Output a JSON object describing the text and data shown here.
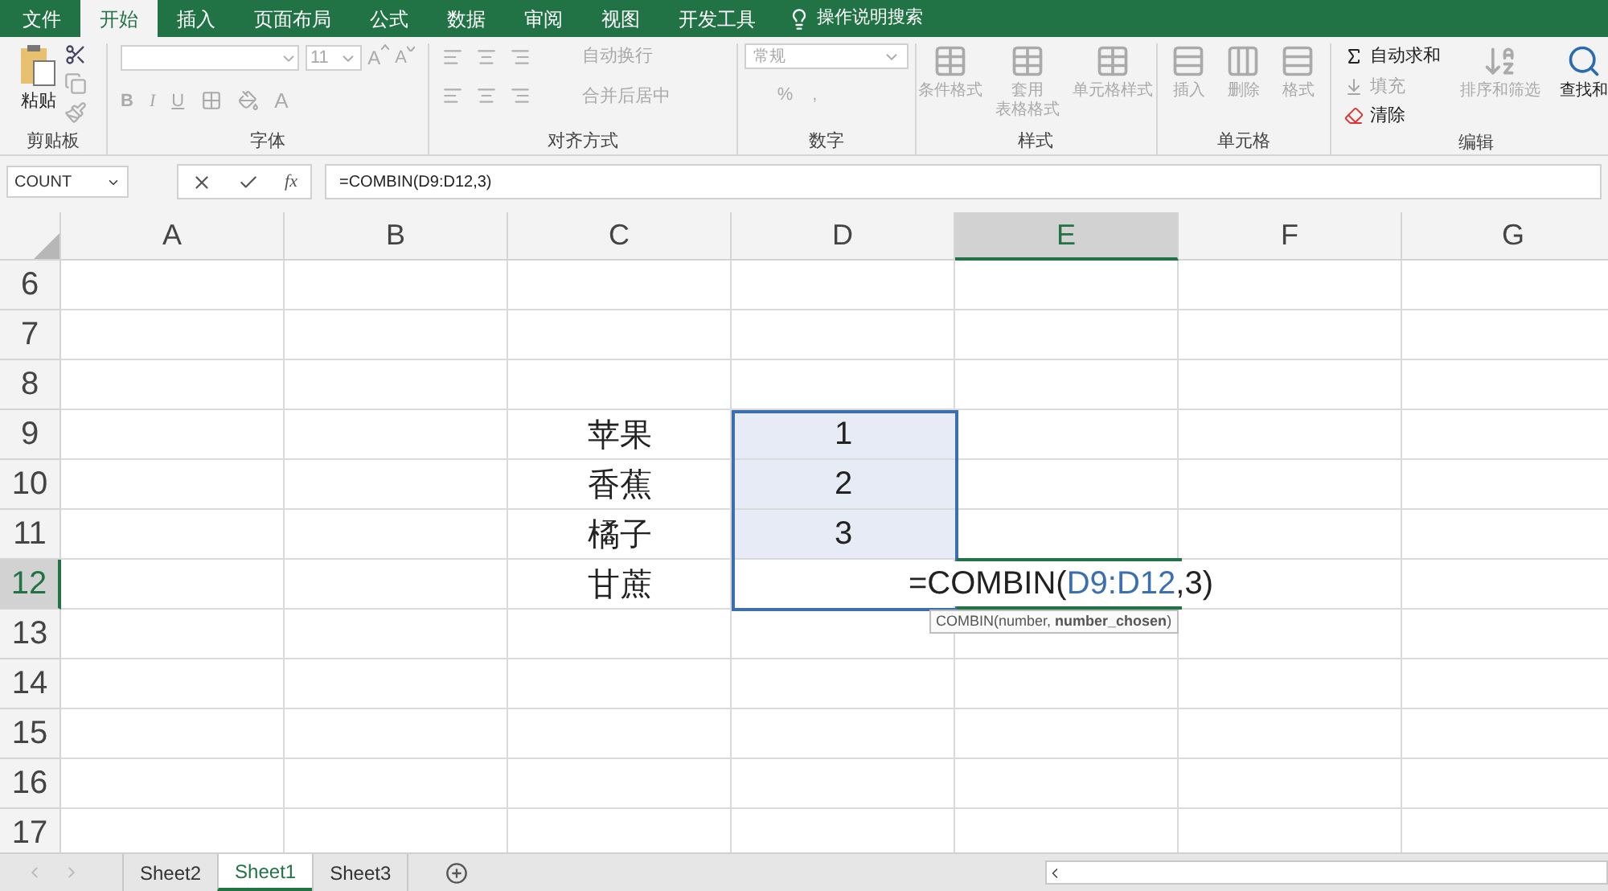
{
  "menu_tabs": [
    {
      "label": "文件",
      "selected": false
    },
    {
      "label": "开始",
      "selected": true
    },
    {
      "label": "插入",
      "selected": false
    },
    {
      "label": "页面布局",
      "selected": false
    },
    {
      "label": "公式",
      "selected": false
    },
    {
      "label": "数据",
      "selected": false
    },
    {
      "label": "审阅",
      "selected": false
    },
    {
      "label": "视图",
      "selected": false
    },
    {
      "label": "开发工具",
      "selected": false
    }
  ],
  "tell_me": "操作说明搜索",
  "ribbon": {
    "clipboard": {
      "title": "剪贴板",
      "paste": "粘贴"
    },
    "font": {
      "title": "字体",
      "font_size": "11",
      "grow_font": "A",
      "shrink_font": "A",
      "bold": "B",
      "italic": "I",
      "underline": "U",
      "font_color": "A"
    },
    "alignment": {
      "title": "对齐方式",
      "wrap": "自动换行",
      "merge": "合并后居中"
    },
    "number": {
      "title": "数字",
      "format": "常规",
      "percent": "%",
      "comma": ","
    },
    "styles": {
      "title": "样式",
      "buttons": [
        {
          "lines": [
            "条件格式"
          ]
        },
        {
          "lines": [
            "套用",
            "表格格式"
          ]
        },
        {
          "lines": [
            "单元格样式"
          ]
        }
      ]
    },
    "cells": {
      "title": "单元格",
      "buttons": [
        "插入",
        "删除",
        "格式"
      ]
    },
    "editing": {
      "title": "编辑",
      "autosum": {
        "label": "自动求和",
        "disabled": false
      },
      "fill": {
        "label": "填充",
        "disabled": true
      },
      "clear": {
        "label": "清除",
        "disabled": false
      },
      "sort": {
        "label": "排序和筛选",
        "disabled": true
      },
      "find": {
        "label": "查找和",
        "disabled": false
      }
    }
  },
  "formula_bar": {
    "name_box": "COUNT",
    "function_button": "fx",
    "formula": "=COMBIN(D9:D12,3)"
  },
  "columns": [
    {
      "label": "A",
      "selected": false
    },
    {
      "label": "B",
      "selected": false
    },
    {
      "label": "C",
      "selected": false
    },
    {
      "label": "D",
      "selected": false
    },
    {
      "label": "E",
      "selected": true
    },
    {
      "label": "F",
      "selected": false
    },
    {
      "label": "G",
      "selected": false
    }
  ],
  "rows": [
    {
      "number": "6",
      "selected": false,
      "in_range": false
    },
    {
      "number": "7",
      "selected": false,
      "in_range": false
    },
    {
      "number": "8",
      "selected": false,
      "in_range": false
    },
    {
      "number": "9",
      "selected": false,
      "in_range": true,
      "name": "苹果",
      "value": "1"
    },
    {
      "number": "10",
      "selected": false,
      "in_range": true,
      "name": "香蕉",
      "value": "2"
    },
    {
      "number": "11",
      "selected": false,
      "in_range": true,
      "name": "橘子",
      "value": "3"
    },
    {
      "number": "12",
      "selected": true,
      "in_range": false,
      "name": "甘蔗"
    },
    {
      "number": "13",
      "selected": false,
      "in_range": false
    },
    {
      "number": "14",
      "selected": false,
      "in_range": false
    },
    {
      "number": "15",
      "selected": false,
      "in_range": false
    },
    {
      "number": "16",
      "selected": false,
      "in_range": false
    },
    {
      "number": "17",
      "selected": false,
      "in_range": false
    }
  ],
  "cell_edit": {
    "prefix": "=COMBIN(",
    "reference": "D9:D12",
    "suffix": ",3)",
    "tooltip": "COMBIN(number, **number_chosen**)"
  },
  "sheet_tabs": [
    {
      "label": "Sheet2",
      "selected": false
    },
    {
      "label": "Sheet1",
      "selected": true
    },
    {
      "label": "Sheet3",
      "selected": false
    }
  ]
}
